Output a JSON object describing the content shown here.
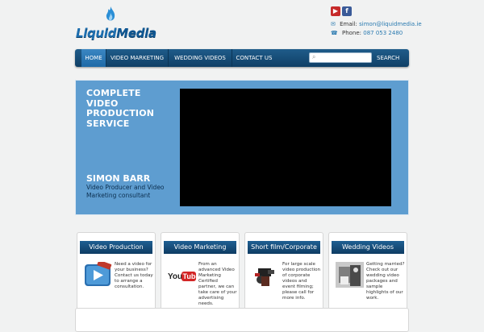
{
  "header": {
    "logo_text": "Liquid",
    "logo_text_2": "Media",
    "social": [
      {
        "icon": "youtube-icon",
        "label": "▶"
      },
      {
        "icon": "facebook-icon",
        "label": "f"
      }
    ],
    "email_label": "Email:",
    "email_value": "simon@liquidmedia.ie",
    "phone_label": "Phone:",
    "phone_value": "087 053 2480"
  },
  "nav": {
    "items": [
      {
        "label": "HOME",
        "active": true
      },
      {
        "label": "VIDEO MARKETING"
      },
      {
        "label": "WEDDING VIDEOS"
      },
      {
        "label": "CONTACT US"
      }
    ],
    "search_placeholder": "",
    "search_label": "SEARCH"
  },
  "banner": {
    "title": "COMPLETE VIDEO PRODUCTION SERVICE",
    "name": "SIMON BARR",
    "subtitle": "Video Producer and Video Marketing consultant"
  },
  "cards": [
    {
      "title": "Video Production",
      "text": "Need a video for your business? Contact us today to arrange a consultation.",
      "icon": "video-icon"
    },
    {
      "title": "Video Marketing",
      "text": "From an advanced Video Marketing Certified partner, we can take care of your advertising needs.",
      "icon": "youtube-logo-icon"
    },
    {
      "title": "Short film/Corporate",
      "text": "For large scale video production of corporate videos and event filming; please call for more info.",
      "icon": "camera-operator-image"
    },
    {
      "title": "Wedding Videos",
      "text": "Getting married? Check out our wedding video packages and sample highlights of our work.",
      "icon": "wedding-image"
    }
  ],
  "colors": {
    "accent": "#1d6fb0",
    "nav": "#12456e",
    "banner": "#5e9dd0"
  }
}
